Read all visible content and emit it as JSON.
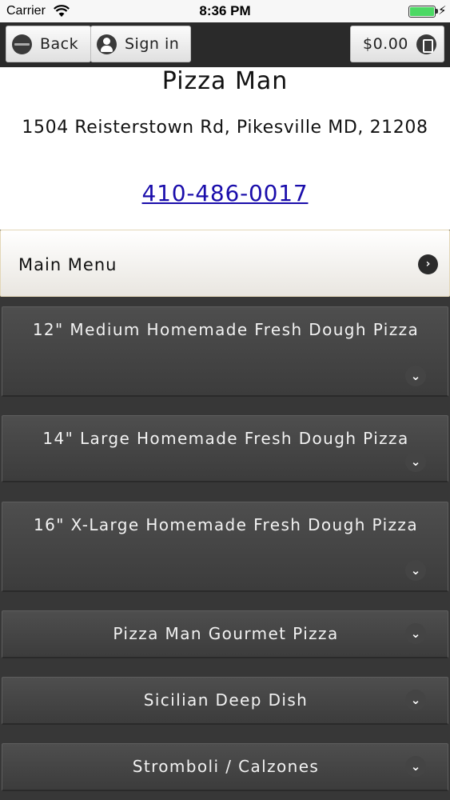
{
  "status_bar": {
    "carrier": "Carrier",
    "time": "8:36 PM",
    "battery_color": "#4cd964"
  },
  "nav": {
    "back_label": "Back",
    "signin_label": "Sign in",
    "cart_total": "$0.00"
  },
  "restaurant": {
    "name": "Pizza Man",
    "address": "1504 Reisterstown Rd, Pikesville MD, 21208",
    "phone": "410-486-0017"
  },
  "main_menu": {
    "label": "Main Menu"
  },
  "categories": [
    {
      "label": "12\" Medium Homemade Fresh Dough Pizza"
    },
    {
      "label": "14\" Large Homemade Fresh Dough Pizza"
    },
    {
      "label": "16\" X-Large Homemade Fresh Dough Pizza"
    },
    {
      "label": "Pizza Man Gourmet Pizza"
    },
    {
      "label": "Sicilian Deep Dish"
    },
    {
      "label": "Stromboli / Calzones"
    }
  ],
  "colors": {
    "nav_background": "#2a2a2a",
    "list_background": "#373737",
    "link_color": "#1a0dab"
  }
}
